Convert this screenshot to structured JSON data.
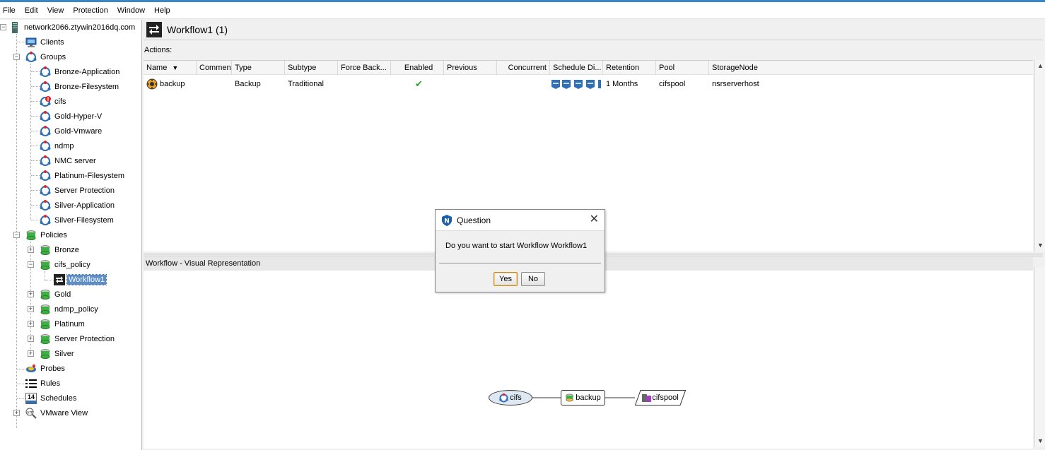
{
  "menu": [
    "File",
    "Edit",
    "View",
    "Protection",
    "Window",
    "Help"
  ],
  "tree": {
    "server": "network2066.ztywin2016dq.com",
    "clients": "Clients",
    "groups": "Groups",
    "group_items": [
      "Bronze-Application",
      "Bronze-Filesystem",
      "cifs",
      "Gold-Hyper-V",
      "Gold-Vmware",
      "ndmp",
      "NMC server",
      "Platinum-Filesystem",
      "Server Protection",
      "Silver-Application",
      "Silver-Filesystem"
    ],
    "policies": "Policies",
    "policy_items": [
      "Bronze",
      "cifs_policy",
      "Gold",
      "ndmp_policy",
      "Platinum",
      "Server Protection",
      "Silver"
    ],
    "workflow_selected": "Workflow1",
    "probes": "Probes",
    "rules": "Rules",
    "schedules": "Schedules",
    "schedules_icon_number": "14",
    "vmware": "VMware View"
  },
  "header": {
    "title": "Workflow1 (1)"
  },
  "actions_label": "Actions:",
  "table": {
    "columns": [
      "Name",
      "Comment",
      "Type",
      "Subtype",
      "Force Back...",
      "Enabled",
      "Previous",
      "Concurrent",
      "Schedule Di...",
      "Retention",
      "Pool",
      "StorageNode"
    ],
    "row": {
      "name": "backup",
      "comment": "",
      "type": "Backup",
      "subtype": "Traditional",
      "force_backup": "",
      "enabled": true,
      "previous": "",
      "concurrent": "",
      "retention": "1 Months",
      "pool": "cifspool",
      "storage_node": "nsrserverhost"
    }
  },
  "visual": {
    "header": "Workflow - Visual Representation",
    "nodes": [
      "cifs",
      "backup",
      "cifspool"
    ]
  },
  "dialog": {
    "title": "Question",
    "message": "Do you want to start Workflow Workflow1",
    "yes": "Yes",
    "no": "No"
  },
  "colors": {
    "accent": "#3a87c8",
    "selection": "#5f8ec7",
    "policy_green": "#3cb043",
    "check_green": "#2e9e2e"
  }
}
